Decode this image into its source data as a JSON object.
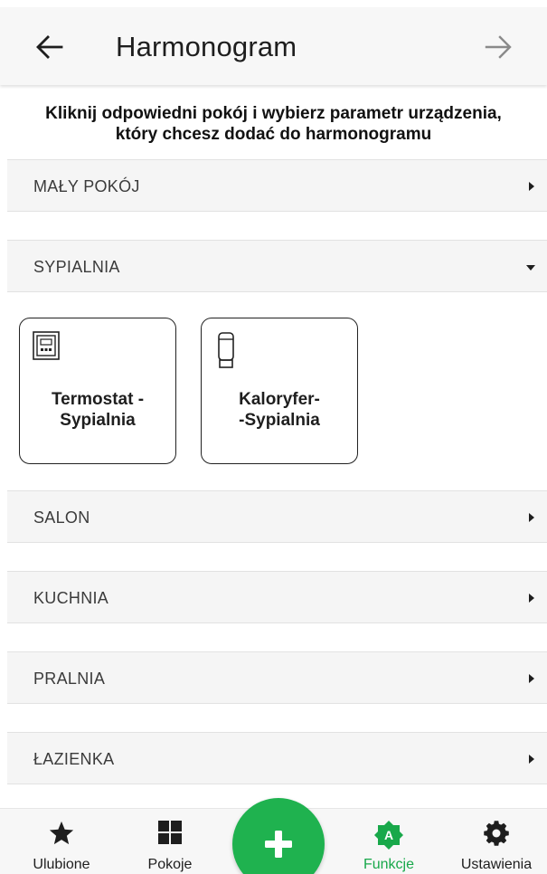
{
  "header": {
    "title": "Harmonogram",
    "back_icon": "arrow-left-icon",
    "forward_icon": "arrow-right-icon"
  },
  "instruction": {
    "line1": "Kliknij odpowiedni pokój i wybierz parametr urządzenia,",
    "line2": "który chcesz dodać do harmonogramu"
  },
  "rooms": [
    {
      "label": "MAŁY POKÓJ",
      "expanded": false
    },
    {
      "label": "SYPIALNIA",
      "expanded": true
    },
    {
      "label": "SALON",
      "expanded": false
    },
    {
      "label": "KUCHNIA",
      "expanded": false
    },
    {
      "label": "PRALNIA",
      "expanded": false
    },
    {
      "label": "ŁAZIENKA",
      "expanded": false
    }
  ],
  "devices": [
    {
      "line1": "Termostat -",
      "line2": "Sypialnia",
      "icon": "thermostat-icon"
    },
    {
      "line1": "Kaloryfer-",
      "line2": "-Sypialnia",
      "icon": "radiator-head-icon"
    }
  ],
  "bottom_nav": {
    "items": [
      {
        "label": "Ulubione",
        "icon": "star-icon"
      },
      {
        "label": "Pokoje",
        "icon": "grid-icon"
      },
      {
        "label": "Funkcje",
        "icon": "functions-icon",
        "active": true
      },
      {
        "label": "Ustawienia",
        "icon": "gear-icon"
      }
    ],
    "fab_icon": "plus-icon",
    "active_color": "#18a84a",
    "fab_color": "#1fb24f"
  }
}
